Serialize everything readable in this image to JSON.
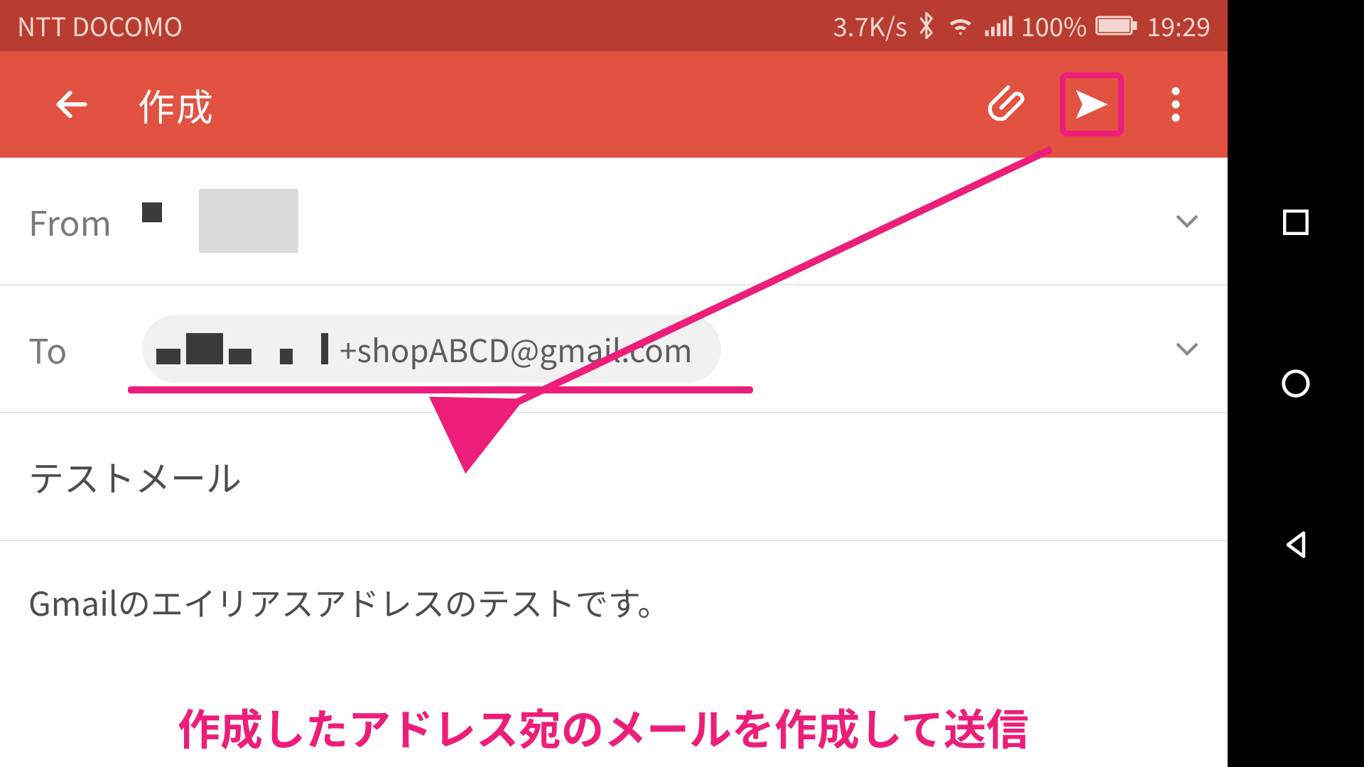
{
  "statusbar": {
    "carrier": "NTT DOCOMO",
    "data_rate": "3.7K/s",
    "battery_pct": "100%",
    "clock": "19:29"
  },
  "toolbar": {
    "title": "作成"
  },
  "compose": {
    "from_label": "From",
    "to_label": "To",
    "to_chip_address_suffix": "+shopABCD@gmail.com",
    "subject": "テストメール",
    "body": "Gmailのエイリアスアドレスのテストです。"
  },
  "annotation": {
    "text": "作成したアドレス宛のメールを作成して送信"
  },
  "colors": {
    "accent": "#E15241",
    "status": "#B83C2F",
    "highlight": "#EC1E79"
  }
}
